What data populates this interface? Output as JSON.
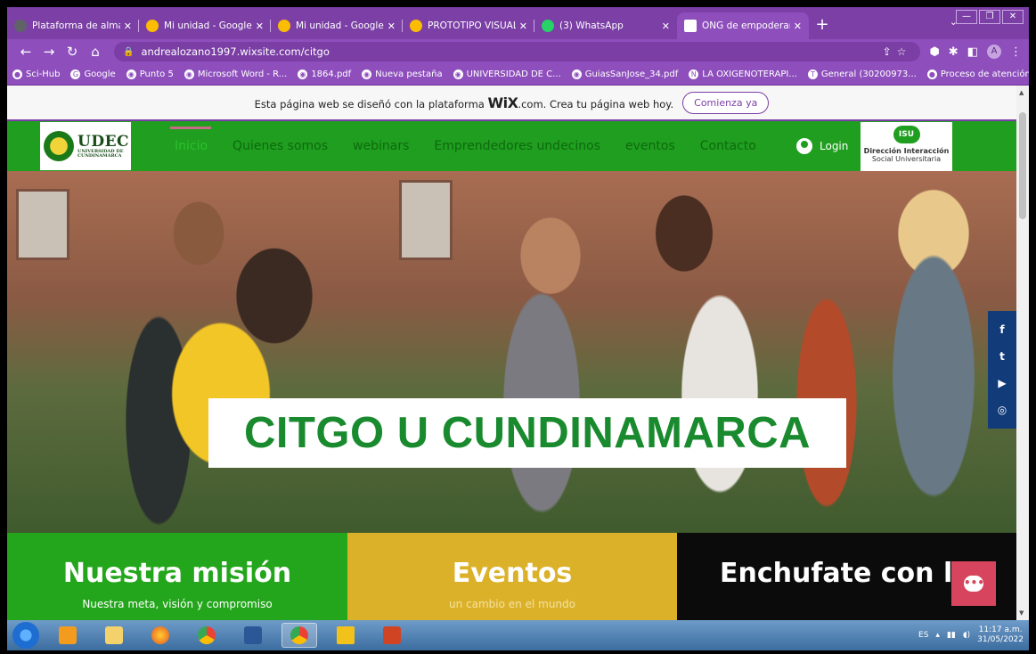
{
  "browser": {
    "tabs": [
      {
        "title": "Plataforma de almacenam",
        "color": "#5f6368"
      },
      {
        "title": "Mi unidad - Google Drive",
        "color": "#fbbc04"
      },
      {
        "title": "Mi unidad - Google Drive",
        "color": "#fbbc04"
      },
      {
        "title": "PROTOTIPO VISUAL DE LA",
        "color": "#fbbc04"
      },
      {
        "title": "(3) WhatsApp",
        "color": "#25d366"
      },
      {
        "title": "ONG de empoderamiento",
        "color": "#ffffff",
        "active": true
      }
    ],
    "new_tab": "+",
    "url": "andrealozano1997.wixsite.com/citgo",
    "profile_initial": "A",
    "bookmarks": [
      "Sci-Hub",
      "Google",
      "Punto 5",
      "Microsoft Word - R...",
      "1864.pdf",
      "Nueva pestaña",
      "UNIVERSIDAD DE C...",
      "GuiasSanJose_34.pdf",
      "LA OXIGENOTERAPI...",
      "General (30200973...",
      "Proceso de atención..."
    ]
  },
  "wix_banner": {
    "text_before": "Esta página web se diseñó con la plataforma",
    "brand": "WiX",
    "text_after": ".com. Crea tu página web hoy.",
    "cta": "Comienza ya"
  },
  "site": {
    "logo_name": "UDEC",
    "logo_sub": "UNIVERSIDAD DE CUNDINAMARCA",
    "menu": [
      "Inicio",
      "Quienes somos",
      "webinars",
      "Emprendedores undecinos",
      "eventos",
      "Contacto"
    ],
    "login": "Login",
    "isu_mark": "ISU",
    "isu_line1": "Dirección Interacción",
    "isu_line2": "Social Universitaria",
    "social": [
      "f",
      "t",
      "▶",
      "◎"
    ],
    "hero_title": "CITGO U CUNDINAMARCA",
    "cards": [
      {
        "title": "Nuestra misión",
        "subtitle": "Nuestra meta, visión y compromiso"
      },
      {
        "title": "Eventos",
        "subtitle": "un cambio en el mundo"
      },
      {
        "title": "Enchufate con la",
        "subtitle": ""
      }
    ]
  },
  "taskbar": {
    "lang": "ES",
    "time": "11:17 a.m.",
    "date": "31/05/2022"
  }
}
